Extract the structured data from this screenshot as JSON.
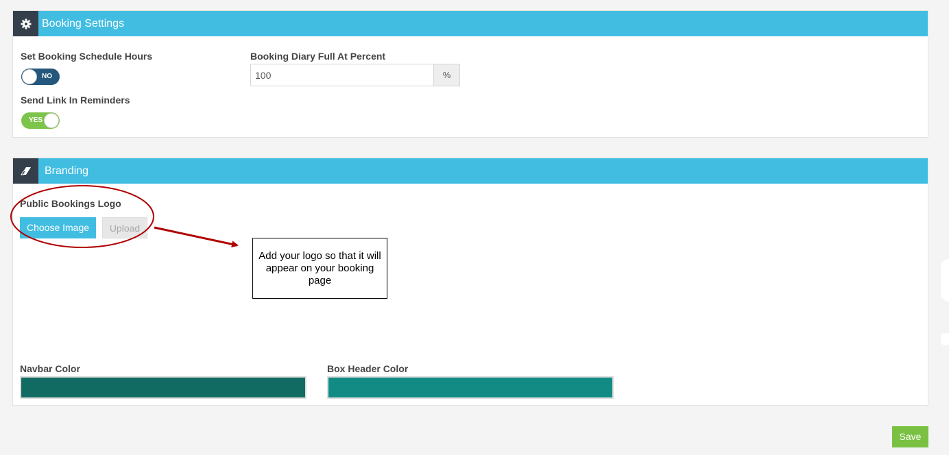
{
  "booking_settings": {
    "title": "Booking Settings",
    "icon": "gear-icon",
    "schedule_hours_label": "Set Booking Schedule Hours",
    "schedule_hours_toggle": "NO",
    "send_link_label": "Send Link In Reminders",
    "send_link_toggle": "YES",
    "diary_full_label": "Booking Diary Full At Percent",
    "diary_full_value": "100",
    "diary_full_addon": "%"
  },
  "branding": {
    "title": "Branding",
    "icon": "eraser-icon",
    "logo_label": "Public Bookings Logo",
    "choose_image_label": "Choose Image",
    "upload_label": "Upload",
    "navbar_color_label": "Navbar Color",
    "navbar_color": "#126b62",
    "box_header_color_label": "Box Header Color",
    "box_header_color": "#128b84"
  },
  "annotation": {
    "callout_text": "Add your logo so that it will appear on your booking page",
    "color": "#b00000"
  },
  "footer": {
    "save_label": "Save"
  },
  "colors": {
    "header": "#41bde2",
    "icon_box": "#353f4b",
    "toggle_no": "#25577c",
    "toggle_yes": "#7dc44a",
    "save": "#7ac143"
  }
}
